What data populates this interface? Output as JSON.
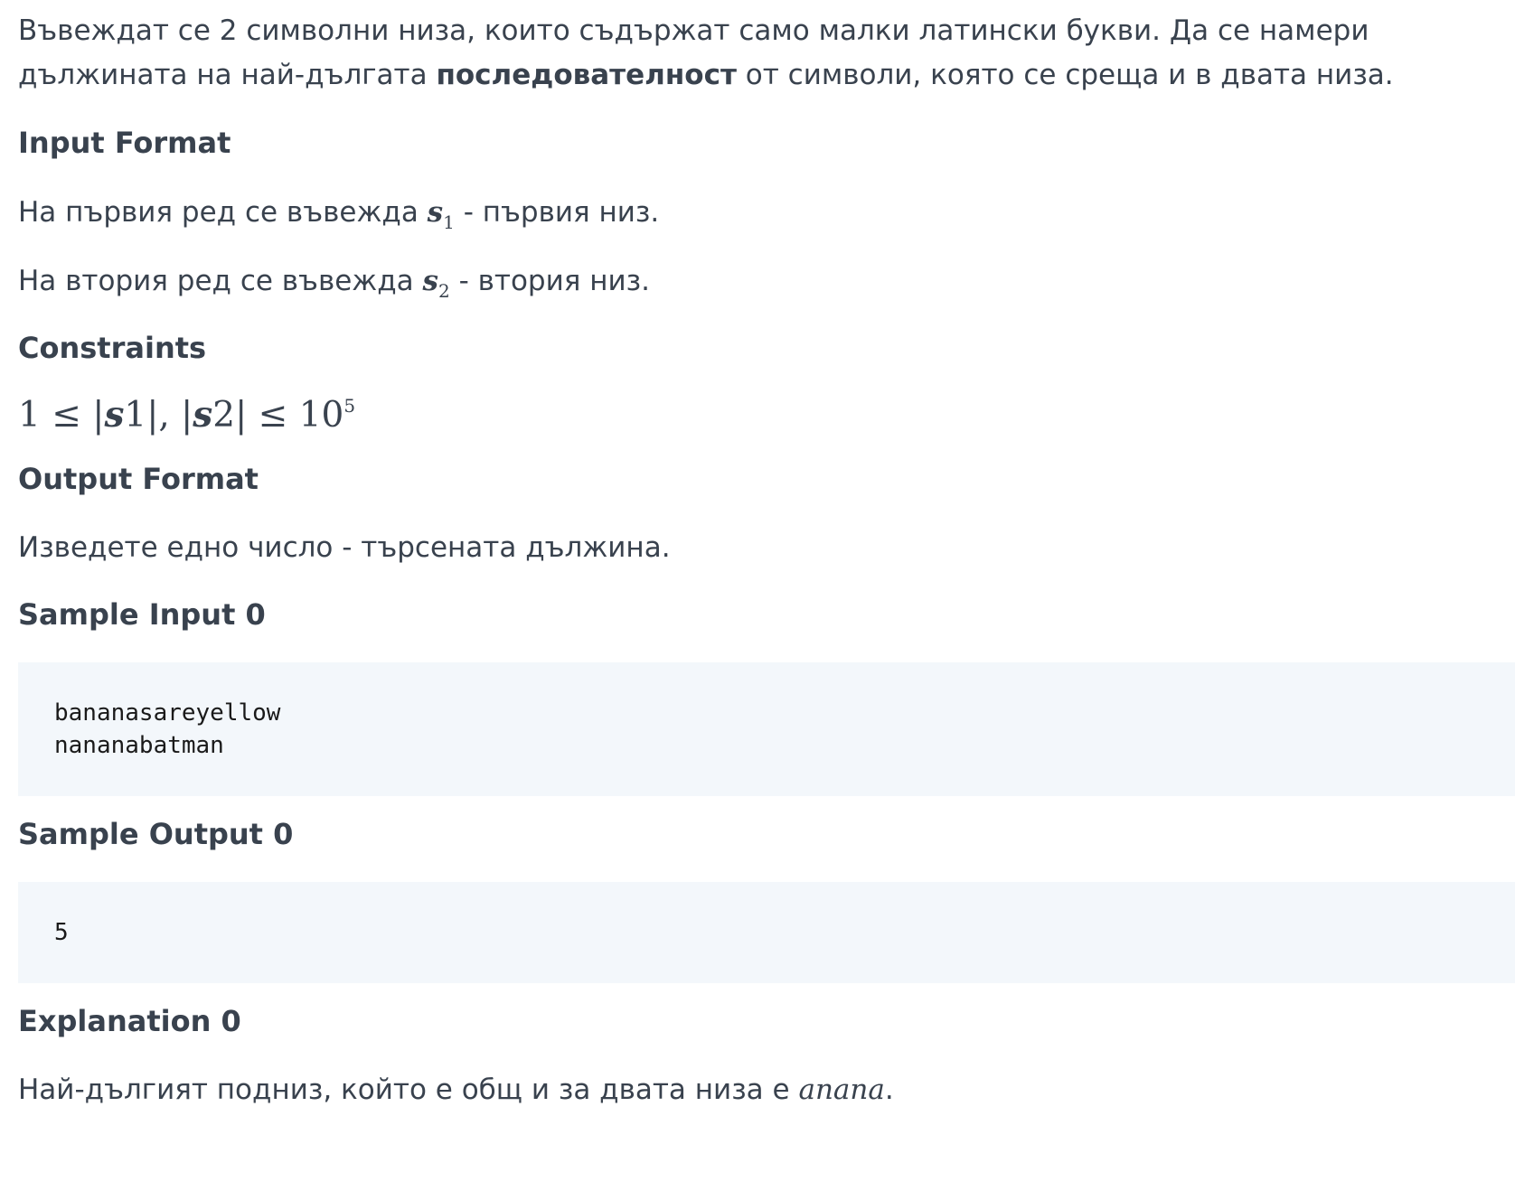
{
  "intro": {
    "line_before_bold": "Въвеждат се 2 символни низа, които съдържат само малки латински букви. Да се намери дължината на най-дългата ",
    "bold": "последователност",
    "line_after_bold": " от символи, която се среща и в двата низа."
  },
  "input_format": {
    "heading": "Input Format",
    "line1_before": "На първия ред се въвежда ",
    "line1_var": "s",
    "line1_sub": "1",
    "line1_after": " - първия низ.",
    "line2_before": "На втория ред се въвежда ",
    "line2_var": "s",
    "line2_sub": "2",
    "line2_after": " - втория низ."
  },
  "constraints": {
    "heading": "Constraints",
    "formula_start": "1 ≤ |",
    "var1": "s",
    "var1_num": "1|, |",
    "var2": "s",
    "var2_num": "2| ≤ 10",
    "exponent": "5"
  },
  "output_format": {
    "heading": "Output Format",
    "text": "Изведете едно число - търсената дължина."
  },
  "sample_input": {
    "heading": "Sample Input 0",
    "code": "bananasareyellow\nnananabatman"
  },
  "sample_output": {
    "heading": "Sample Output 0",
    "code": "5"
  },
  "explanation": {
    "heading": "Explanation 0",
    "text_before": "Най-дългият подниз, който е общ и за двата низа е ",
    "answer": "anana",
    "text_after": "."
  }
}
